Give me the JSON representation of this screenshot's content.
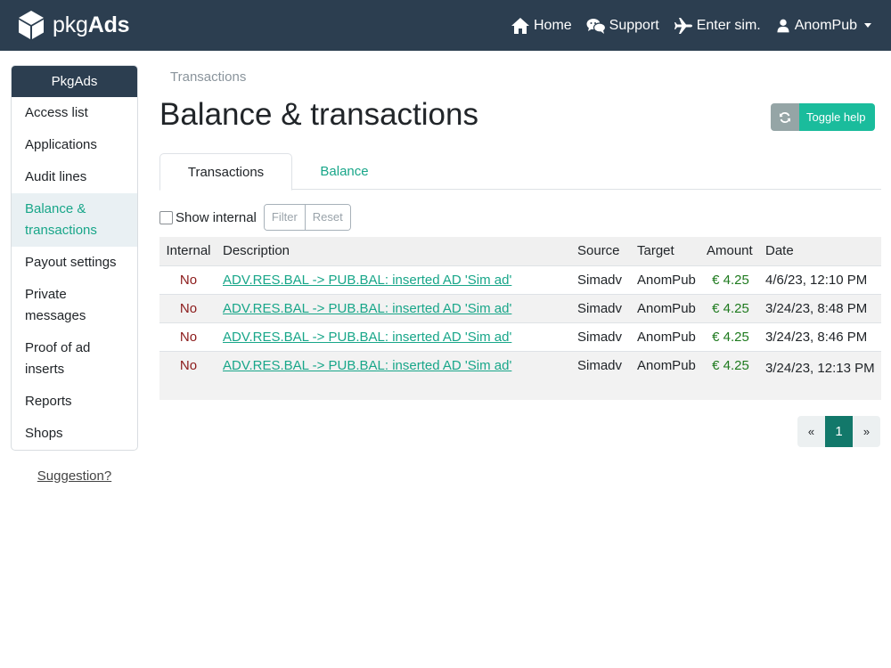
{
  "navbar": {
    "brand_light": "pkg",
    "brand_bold": "Ads",
    "items": [
      {
        "label": "Home",
        "icon": "home-icon"
      },
      {
        "label": "Support",
        "icon": "chat-icon"
      },
      {
        "label": "Enter sim.",
        "icon": "plane-icon"
      },
      {
        "label": "AnomPub",
        "icon": "user-icon"
      }
    ]
  },
  "sidebar": {
    "title": "PkgAds",
    "items": [
      {
        "label": "Access list"
      },
      {
        "label": "Applications"
      },
      {
        "label": "Audit lines"
      },
      {
        "label": "Balance & transactions",
        "active": true
      },
      {
        "label": "Payout settings"
      },
      {
        "label": "Private messages"
      },
      {
        "label": "Proof of ad inserts"
      },
      {
        "label": "Reports"
      },
      {
        "label": "Shops"
      }
    ],
    "suggestion": "Suggestion?"
  },
  "main": {
    "breadcrumb": "Transactions",
    "title": "Balance & transactions",
    "toggle_help": "Toggle help",
    "tabs": [
      {
        "label": "Transactions",
        "active": true
      },
      {
        "label": "Balance",
        "active": false
      }
    ],
    "filter": {
      "show_internal_label": "Show internal",
      "filter_label": "Filter",
      "reset_label": "Reset"
    },
    "table": {
      "headers": [
        "Internal",
        "Description",
        "Source",
        "Target",
        "Amount",
        "Date"
      ],
      "rows": [
        {
          "internal": "No",
          "description": "ADV.RES.BAL -> PUB.BAL: inserted AD 'Sim ad'",
          "source": "Simadv",
          "target": "AnomPub",
          "amount": "€ 4.25",
          "date": "4/6/23, 12:10 PM"
        },
        {
          "internal": "No",
          "description": "ADV.RES.BAL -> PUB.BAL: inserted AD 'Sim ad'",
          "source": "Simadv",
          "target": "AnomPub",
          "amount": "€ 4.25",
          "date": "3/24/23, 8:48 PM"
        },
        {
          "internal": "No",
          "description": "ADV.RES.BAL -> PUB.BAL: inserted AD 'Sim ad'",
          "source": "Simadv",
          "target": "AnomPub",
          "amount": "€ 4.25",
          "date": "3/24/23, 8:46 PM"
        },
        {
          "internal": "No",
          "description": "ADV.RES.BAL -> PUB.BAL: inserted AD 'Sim ad'",
          "source": "Simadv",
          "target": "AnomPub",
          "amount": "€ 4.25",
          "date": "3/24/23, 12:13 PM"
        }
      ]
    },
    "pagination": {
      "prev": "«",
      "current": "1",
      "next": "»"
    }
  },
  "colors": {
    "navbar_bg": "#2c3e50",
    "accent": "#18a689",
    "toggle_help_bg": "#1abc9c",
    "amount_green": "#1e7a1e",
    "internal_no_red": "#8b1a1a",
    "pagination_active": "#12786a"
  }
}
